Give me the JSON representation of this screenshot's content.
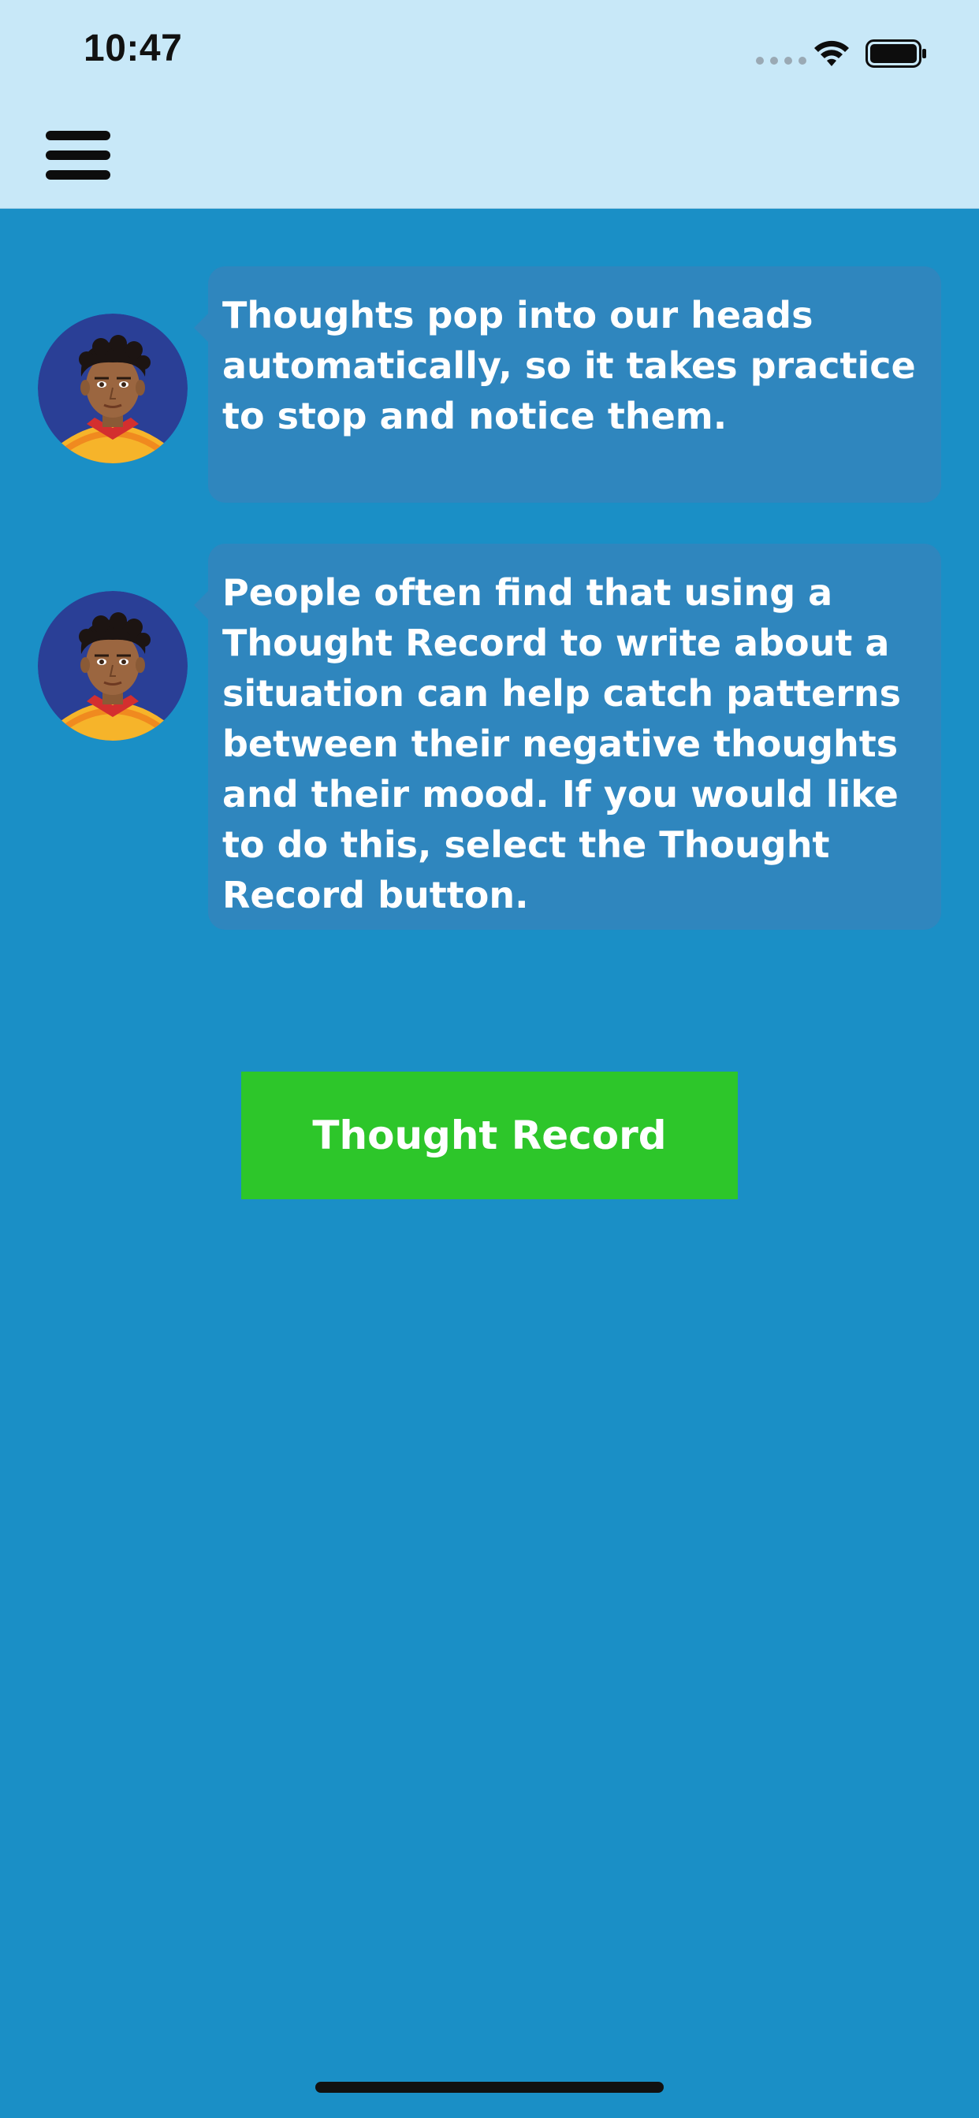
{
  "status_bar": {
    "time": "10:47",
    "icons": [
      "cellular-signal-icon",
      "wifi-icon",
      "battery-icon"
    ]
  },
  "header": {
    "menu_icon": "hamburger-menu-icon"
  },
  "messages": [
    {
      "avatar_icon": "coach-avatar-icon",
      "text": "Thoughts pop into our heads automatically, so it takes practice to stop and notice them."
    },
    {
      "avatar_icon": "coach-avatar-icon",
      "text": "People often find that using a Thought Record to write about a situation can help catch patterns between their negative thoughts and their mood. If you would like to do this, select the Thought Record button."
    }
  ],
  "actions": {
    "thought_record_label": "Thought Record"
  },
  "colors": {
    "background": "#1a8fc6",
    "header_background": "#c8e8f8",
    "bubble": "#2f86be",
    "button": "#2dc62a",
    "text": "#ffffff"
  }
}
